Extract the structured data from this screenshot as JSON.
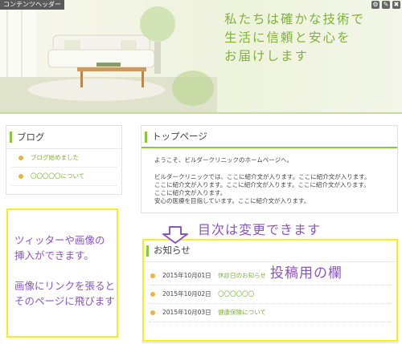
{
  "header": {
    "area_tag": "コンテンツヘッダー",
    "tagline": [
      "私たちは確かな技術で",
      "生活に信頼と安心を",
      "お届けします"
    ],
    "tools": [
      "gear-icon",
      "edit-icon",
      "trash-icon"
    ]
  },
  "sidebar": {
    "title": "ブログ",
    "items": [
      "ブログ始めました",
      "〇〇〇〇〇について"
    ]
  },
  "top_page": {
    "title": "トップページ",
    "welcome": "ようこそ、ビルダークリニックのホームページへ。",
    "lines": [
      "ビルダークリニックでは、ここに紹介文が入ります。ここに紹介文が入ります。",
      "ここに紹介文が入ります。ここに紹介文が入ります。ここに紹介文が入ります。",
      "ここに紹介文が入ります。",
      "安心の医療を目指しています。ここに紹介文が入ります。"
    ]
  },
  "news": {
    "title": "お知らせ",
    "items": [
      {
        "date": "2015年10月01日",
        "title": "休診日のお知らせ"
      },
      {
        "date": "2015年10月02日",
        "title": "〇〇〇〇〇〇"
      },
      {
        "date": "2015年10月03日",
        "title": "健康保険について"
      }
    ]
  },
  "annotations": {
    "left": [
      "ツィッターや画像の",
      "挿入ができます。",
      "",
      "画像にリンクを張ると",
      "そのページに飛びます"
    ],
    "toc": "目次は変更できます",
    "post": "投稿用の欄"
  },
  "colors": {
    "accent": "#8cc63f",
    "link": "#7fb23a",
    "annotation": "#8a55c4",
    "highlight": "#f2ee22"
  }
}
